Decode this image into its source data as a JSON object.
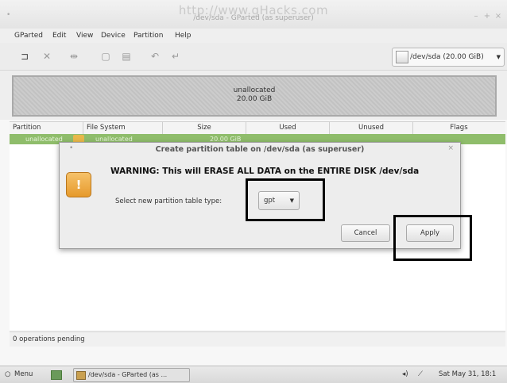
{
  "window": {
    "title": "/dev/sda - GParted (as superuser)",
    "watermark": "http://www.gHacks.com",
    "controls": [
      "–",
      "+",
      "×"
    ]
  },
  "menubar": {
    "items": [
      "GParted",
      "Edit",
      "View",
      "Device",
      "Partition",
      "Help"
    ]
  },
  "toolbar": {
    "icons": [
      "new-icon",
      "delete-icon",
      "resize-icon",
      "copy-icon",
      "paste-icon",
      "undo-icon",
      "apply-icon"
    ],
    "device_select": "/dev/sda  (20.00 GiB)"
  },
  "disk_map": {
    "label": "unallocated",
    "size": "20.00 GiB"
  },
  "table": {
    "headers": [
      "Partition",
      "File System",
      "Size",
      "Used",
      "Unused",
      "Flags"
    ],
    "rows": [
      {
        "partition": "unallocated",
        "file_system": "unallocated",
        "size": "20.00 GiB",
        "used": "",
        "unused": "",
        "flags": ""
      }
    ]
  },
  "status": {
    "text": "0 operations pending"
  },
  "dialog": {
    "title": "Create partition table on /dev/sda (as superuser)",
    "warning": "WARNING:  This will ERASE ALL DATA on the ENTIRE DISK /dev/sda",
    "select_label": "Select new partition table type:",
    "select_value": "gpt",
    "cancel_label": "Cancel",
    "apply_label": "Apply"
  },
  "taskbar": {
    "menu_label": "Menu",
    "app_label": "/dev/sda - GParted (as ...",
    "clock": "Sat May 31, 18:1"
  },
  "colors": {
    "selected_row": "#8fbd6b",
    "warning_icon": "#e69a2c",
    "highlight_box": "#000000"
  }
}
